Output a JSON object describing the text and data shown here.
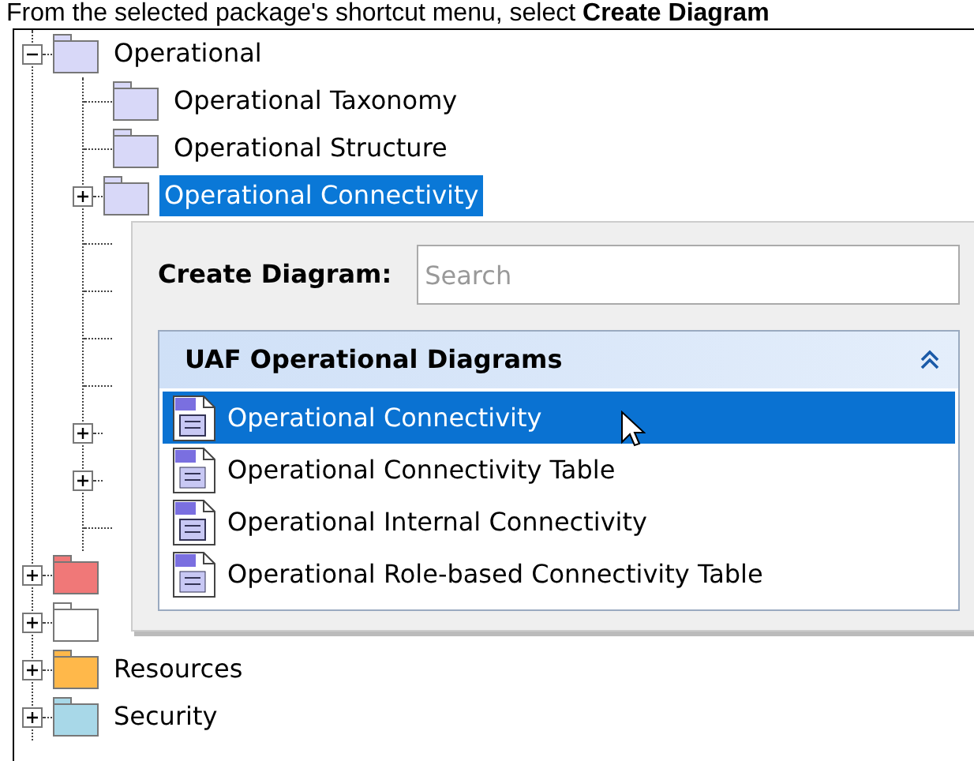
{
  "instruction": "From the selected package's shortcut menu, select **Create Diagram**",
  "tree": [
    {
      "label": "Operational",
      "color": "#d8d8f8",
      "expandable": true,
      "expanded": true,
      "selected": false,
      "children": [
        {
          "label": "Operational Taxonomy",
          "color": "#d8d8f8",
          "expandable": false,
          "selected": false
        },
        {
          "label": "Operational Structure",
          "color": "#d8d8f8",
          "expandable": false,
          "selected": false
        },
        {
          "label": "Operational Connectivity",
          "color": "#d8d8f8",
          "expandable": true,
          "expanded": false,
          "selected": true
        },
        {
          "expandable": false
        },
        {
          "expandable": false
        },
        {
          "expandable": false
        },
        {
          "expandable": false
        },
        {
          "expandable": true,
          "expanded": false
        },
        {
          "expandable": true,
          "expanded": false
        },
        {
          "expandable": false
        }
      ]
    },
    {
      "color": "#f07878",
      "expandable": true,
      "expanded": false
    },
    {
      "color": "#ffffff",
      "expandable": true,
      "expanded": false
    },
    {
      "label": "Resources",
      "color": "#ffb84a",
      "expandable": true,
      "expanded": false,
      "selected": false
    },
    {
      "label": "Security",
      "color": "#a8d8e8",
      "expandable": true,
      "expanded": false,
      "selected": false
    }
  ],
  "popup": {
    "label": "Create Diagram:",
    "search": {
      "placeholder": "Search"
    },
    "group": {
      "title": "UAF Operational Diagrams",
      "expanded": true,
      "items": [
        {
          "label": "Operational Connectivity",
          "selected": true
        },
        {
          "label": "Operational Connectivity Table",
          "selected": false
        },
        {
          "label": "Operational Internal Connectivity",
          "selected": false
        },
        {
          "label": "Operational Role-based Connectivity Table",
          "selected": false
        }
      ]
    }
  }
}
